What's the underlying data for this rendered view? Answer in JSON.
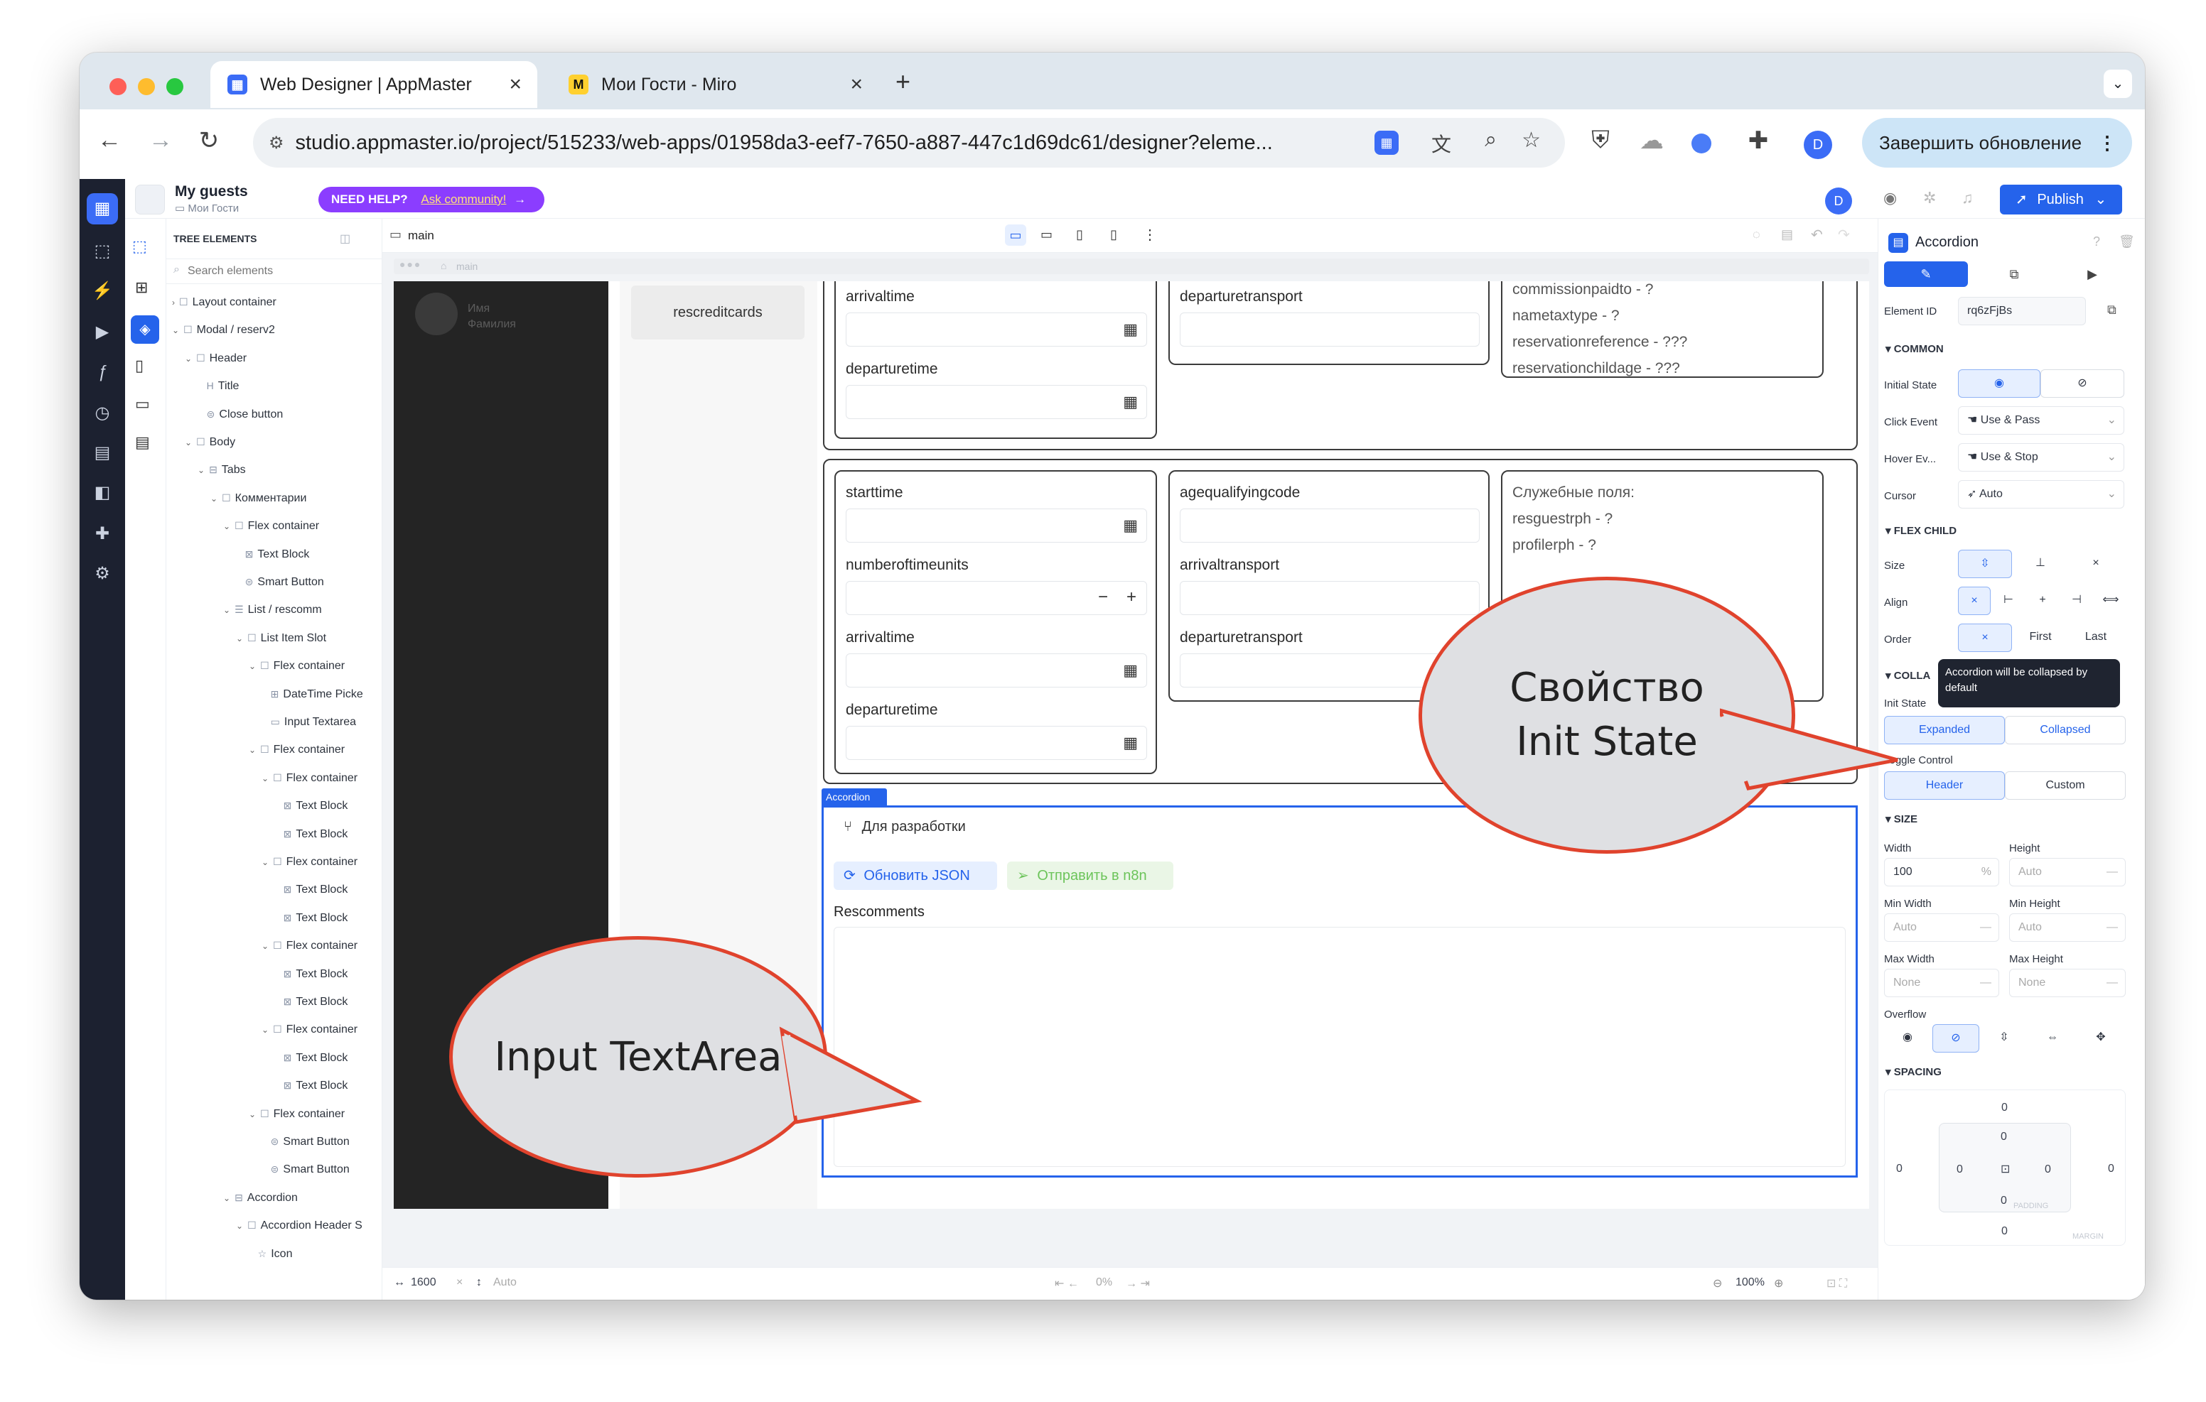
{
  "browser": {
    "tabs": [
      {
        "title": "Web Designer | AppMaster",
        "active": true
      },
      {
        "title": "Мои Гости - Miro",
        "active": false
      }
    ],
    "new_tab_symbol": "+",
    "url": "studio.appmaster.io/project/515233/web-apps/01958da3-eef7-7650-a887-447c1d69dc61/designer?eleme...",
    "profile_letter": "D",
    "update_button": "Завершить обновление"
  },
  "app": {
    "project_name": "My guests",
    "project_sub": "Мои Гости",
    "help_badge": "NEED HELP?",
    "help_link": "Ask community!",
    "avatar": "D",
    "publish": "Publish",
    "page_name": "main",
    "frame_title": "main"
  },
  "tree": {
    "header": "TREE ELEMENTS",
    "search_placeholder": "Search elements",
    "items": [
      {
        "label": "Layout container",
        "indent": 0,
        "icon": "square"
      },
      {
        "label": "Modal / reserv2",
        "indent": 0,
        "icon": "square"
      },
      {
        "label": "Header",
        "indent": 1,
        "icon": "square"
      },
      {
        "label": "Title",
        "indent": 2,
        "icon": "heading"
      },
      {
        "label": "Close button",
        "indent": 2,
        "icon": "button"
      },
      {
        "label": "Body",
        "indent": 1,
        "icon": "square"
      },
      {
        "label": "Tabs",
        "indent": 2,
        "icon": "tabs"
      },
      {
        "label": "Комментарии",
        "indent": 3,
        "icon": "square"
      },
      {
        "label": "Flex container",
        "indent": 4,
        "icon": "square"
      },
      {
        "label": "Text Block",
        "indent": 5,
        "icon": "text"
      },
      {
        "label": "Smart Button",
        "indent": 5,
        "icon": "button"
      },
      {
        "label": "List / rescomm",
        "indent": 4,
        "icon": "list"
      },
      {
        "label": "List Item Slot",
        "indent": 5,
        "icon": "square"
      },
      {
        "label": "Flex container",
        "indent": 6,
        "icon": "square"
      },
      {
        "label": "DateTime Picke",
        "indent": 7,
        "icon": "datetime"
      },
      {
        "label": "Input Textarea",
        "indent": 7,
        "icon": "textarea"
      },
      {
        "label": "Flex container",
        "indent": 6,
        "icon": "square"
      },
      {
        "label": "Flex container",
        "indent": 7,
        "icon": "square"
      },
      {
        "label": "Text Block",
        "indent": 8,
        "icon": "text"
      },
      {
        "label": "Text Block",
        "indent": 8,
        "icon": "text"
      },
      {
        "label": "Flex container",
        "indent": 7,
        "icon": "square"
      },
      {
        "label": "Text Block",
        "indent": 8,
        "icon": "text"
      },
      {
        "label": "Text Block",
        "indent": 8,
        "icon": "text"
      },
      {
        "label": "Flex container",
        "indent": 7,
        "icon": "square"
      },
      {
        "label": "Text Block",
        "indent": 8,
        "icon": "text"
      },
      {
        "label": "Text Block",
        "indent": 8,
        "icon": "text"
      },
      {
        "label": "Flex container",
        "indent": 7,
        "icon": "square"
      },
      {
        "label": "Text Block",
        "indent": 8,
        "icon": "text"
      },
      {
        "label": "Text Block",
        "indent": 8,
        "icon": "text"
      },
      {
        "label": "Flex container",
        "indent": 6,
        "icon": "square"
      },
      {
        "label": "Smart Button",
        "indent": 7,
        "icon": "button"
      },
      {
        "label": "Smart Button",
        "indent": 7,
        "icon": "button"
      },
      {
        "label": "Accordion",
        "indent": 4,
        "icon": "accordion"
      },
      {
        "label": "Accordion Header S",
        "indent": 5,
        "icon": "square"
      },
      {
        "label": "Icon",
        "indent": 6,
        "icon": "star"
      }
    ]
  },
  "canvas": {
    "sidebar_name": "Имя\nФамилия",
    "tab_rescreditcards": "rescreditcards",
    "top": {
      "arrivaltime": "arrivaltime",
      "departuretime": "departuretime",
      "departuretransport": "departuretransport",
      "service": [
        "commissionpaidto - ?",
        "nametaxtype - ?",
        "reservationreference - ???",
        "reservationchildage - ???"
      ]
    },
    "second": {
      "starttime": "starttime",
      "numberofunits": "numberoftimeunits",
      "arrivaltime": "arrivaltime",
      "departuretime": "departuretime",
      "agequalifyingcode": "agequalifyingcode",
      "arrivaltransport": "arrivaltransport",
      "departuretransport": "departuretransport",
      "service_title": "Служебные поля:",
      "service": [
        "resguestrph - ?",
        "profilerph - ?"
      ]
    },
    "accordion_tag": "Accordion",
    "accordion_title": "Для разработки",
    "btn_update": "Обновить JSON",
    "btn_send": "Отправить в n8n",
    "rescomments": "Rescomments"
  },
  "bottombar": {
    "width": "1600",
    "height": "Auto",
    "scroll": "0%",
    "zoom": "100%"
  },
  "props": {
    "title": "Accordion",
    "element_id_label": "Element ID",
    "element_id": "rq6zFjBs",
    "common": "COMMON",
    "initial_state": "Initial State",
    "click_event": "Click Event",
    "click_value": "Use & Pass",
    "hover_event": "Hover Ev...",
    "hover_value": "Use & Stop",
    "cursor": "Cursor",
    "cursor_value": "Auto",
    "flex_child": "FLEX CHILD",
    "size": "Size",
    "align": "Align",
    "order": "Order",
    "order_first": "First",
    "order_last": "Last",
    "collapse": "COLLA",
    "tooltip": "Accordion will be collapsed by default",
    "init_state": "Init State",
    "expanded": "Expanded",
    "collapsed": "Collapsed",
    "toggle_control": "Toggle Control",
    "toggle_header": "Header",
    "toggle_custom": "Custom",
    "size_section": "SIZE",
    "width_label": "Width",
    "width_value": "100",
    "width_unit": "%",
    "height_label": "Height",
    "height_value": "Auto",
    "min_width": "Min Width",
    "min_width_v": "Auto",
    "min_height": "Min Height",
    "min_height_v": "Auto",
    "max_width": "Max Width",
    "max_width_v": "None",
    "max_height": "Max Height",
    "max_height_v": "None",
    "overflow": "Overflow",
    "spacing": "SPACING",
    "sp_margin_top": "0",
    "sp_margin_left": "0",
    "sp_margin_right": "0",
    "sp_margin_bottom": "0",
    "sp_pad_top": "0",
    "sp_pad_left": "0",
    "sp_pad_right": "0",
    "sp_pad_bottom": "0",
    "padding_tag": "PADDING",
    "margin_tag": "MARGIN"
  },
  "callouts": {
    "init_state": "Свойство Init State",
    "textarea": "Input TextArea"
  },
  "colors": {
    "accent": "#2563eb",
    "callout_border": "#e0432d",
    "help_purple": "#8b3dff",
    "dark_rail": "#1c2130"
  }
}
